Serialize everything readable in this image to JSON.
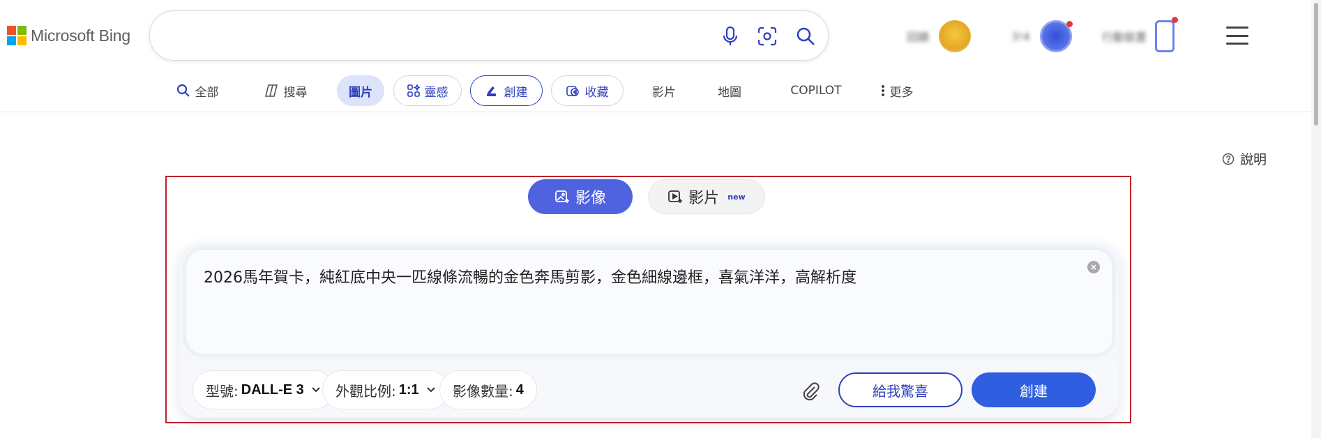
{
  "header": {
    "logo_text": "Microsoft Bing",
    "search": {
      "value": "",
      "placeholder": ""
    },
    "icons": [
      "microphone-icon",
      "visual-search-icon",
      "search-icon"
    ],
    "user_rewards_label": "回饋",
    "user_points_label": "3!4",
    "mobile_label": "行動裝置",
    "colors": {
      "ms_red": "#f25022",
      "ms_green": "#7fba00",
      "ms_blue": "#00a4ef",
      "ms_yellow": "#ffb900"
    }
  },
  "nav": {
    "items": [
      {
        "label": "全部",
        "icon": "search-icon"
      },
      {
        "label": "搜尋",
        "icon": "copilot-icon"
      },
      {
        "label": "圖片",
        "state": "active"
      },
      {
        "label": "靈感",
        "icon": "sparkle-icon"
      },
      {
        "label": "創建",
        "icon": "create-icon"
      },
      {
        "label": "收藏",
        "icon": "collection-icon"
      },
      {
        "label": "影片"
      },
      {
        "label": "地圖"
      },
      {
        "label": "COPILOT"
      },
      {
        "label": "更多",
        "icon": "more-icon"
      }
    ]
  },
  "help": {
    "label": "說明"
  },
  "creator": {
    "tabs": [
      {
        "label": "影像",
        "selected": true
      },
      {
        "label": "影片",
        "badge": "new",
        "selected": false
      }
    ],
    "prompt": "2026馬年賀卡，純紅底中央一匹線條流暢的金色奔馬剪影，金色細線邊框，喜氣洋洋，高解析度",
    "options": {
      "model_label": "型號:",
      "model_value": "DALL-E 3",
      "aspect_label": "外觀比例:",
      "aspect_value": "1:1",
      "count_label": "影像數量:",
      "count_value": "4"
    },
    "surprise_label": "給我驚喜",
    "create_label": "創建",
    "accent": "#2f5fe0"
  }
}
